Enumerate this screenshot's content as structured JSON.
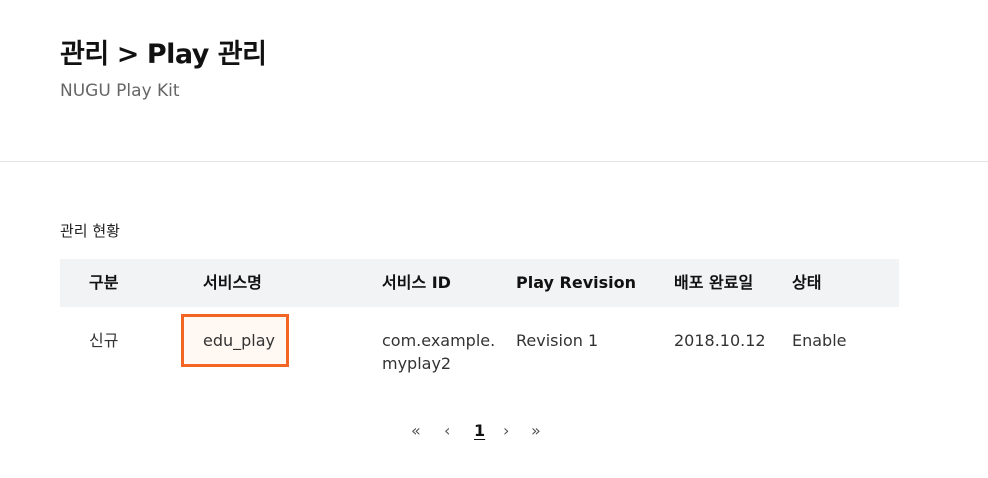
{
  "header": {
    "breadcrumb_parent": "관리",
    "breadcrumb_separator": ">",
    "breadcrumb_current": "Play 관리",
    "subtitle": "NUGU Play Kit"
  },
  "section": {
    "title": "관리 현황"
  },
  "table": {
    "columns": [
      "구분",
      "서비스명",
      "서비스 ID",
      "Play Revision",
      "배포 완료일",
      "상태"
    ],
    "rows": [
      {
        "type": "신규",
        "service_name": "edu_play",
        "service_id": "com.example.myplay2",
        "revision": "Revision 1",
        "deploy_date": "2018.10.12",
        "status": "Enable"
      }
    ]
  },
  "pagination": {
    "first": "«",
    "prev": "‹",
    "current_page": "1",
    "next": "›",
    "last": "»"
  },
  "colors": {
    "highlight": "#f26522",
    "header_bg": "#f2f3f5"
  }
}
